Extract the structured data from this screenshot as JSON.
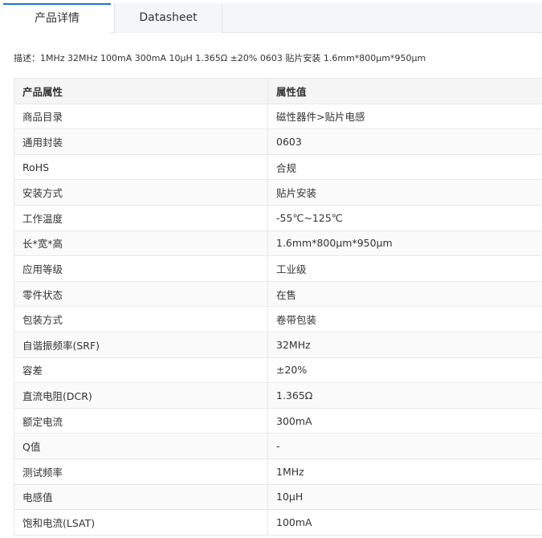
{
  "tabs": [
    {
      "label": "产品详情",
      "active": true
    },
    {
      "label": "Datasheet",
      "active": false
    }
  ],
  "description": "描述：1MHz 32MHz 100mA 300mA 10μH 1.365Ω ±20% 0603 贴片安装 1.6mm*800μm*950μm",
  "table": {
    "headers": [
      "产品属性",
      "属性值"
    ],
    "rows": [
      [
        "商品目录",
        "磁性器件>贴片电感"
      ],
      [
        "通用封装",
        "0603"
      ],
      [
        "RoHS",
        "合规"
      ],
      [
        "安装方式",
        "贴片安装"
      ],
      [
        "工作温度",
        "-55℃~125℃"
      ],
      [
        "长*宽*高",
        "1.6mm*800μm*950μm"
      ],
      [
        "应用等级",
        "工业级"
      ],
      [
        "零件状态",
        "在售"
      ],
      [
        "包装方式",
        "卷带包装"
      ],
      [
        "自谐振频率(SRF)",
        "32MHz"
      ],
      [
        "容差",
        "±20%"
      ],
      [
        "直流电阻(DCR)",
        "1.365Ω"
      ],
      [
        "额定电流",
        "300mA"
      ],
      [
        "Q值",
        "-"
      ],
      [
        "测试频率",
        "1MHz"
      ],
      [
        "电感值",
        "10μH"
      ],
      [
        "饱和电流(LSAT)",
        "100mA"
      ]
    ]
  },
  "colors": {
    "active_tab_border": "#1b73d2",
    "header_bg": "#f5f5f5",
    "tab_bar_bg": "#f5f6f7",
    "border": "#e8e8e8"
  }
}
